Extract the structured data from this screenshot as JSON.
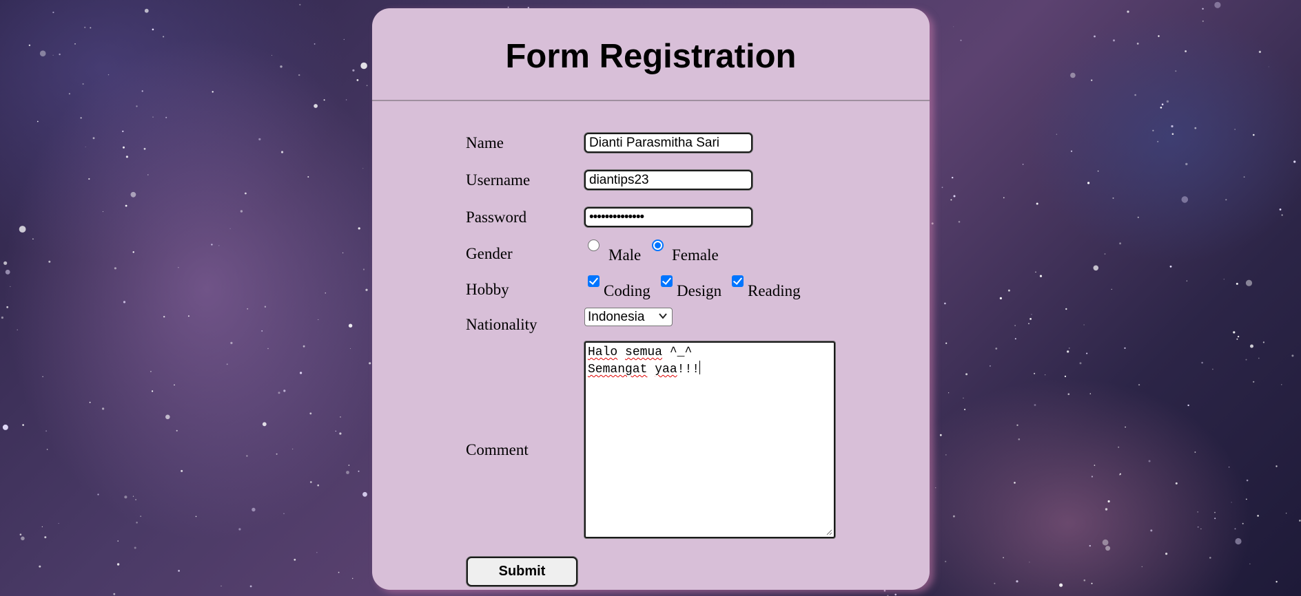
{
  "form": {
    "title": "Form Registration",
    "fields": {
      "name_label": "Name",
      "name_value": "Dianti Parasmitha Sari",
      "username_label": "Username",
      "username_value": "diantips23",
      "password_label": "Password",
      "password_masked": "••••••••••••••",
      "gender_label": "Gender",
      "gender_options": [
        "Male",
        "Female"
      ],
      "gender_selected": "Female",
      "hobby_label": "Hobby",
      "hobby_options": [
        "Coding",
        "Design",
        "Reading"
      ],
      "hobby_checked": [
        "Coding",
        "Design",
        "Reading"
      ],
      "nationality_label": "Nationality",
      "nationality_value": "Indonesia",
      "comment_label": "Comment",
      "comment_lines": {
        "line1_word1": "Halo",
        "line1_word2": "semua",
        "line1_rest": " ^_^",
        "line2_word1": "Semangat",
        "line2_word2": "yaa",
        "line2_rest": "!!!"
      }
    },
    "submit_label": "Submit"
  },
  "colors": {
    "card_background": "#d8bfd8",
    "accent": "#0075ff",
    "spellcheck": "#e00000"
  },
  "icons": {
    "select_chevron": "chevron-down-icon",
    "textarea_resize": "resize-grip-icon"
  }
}
